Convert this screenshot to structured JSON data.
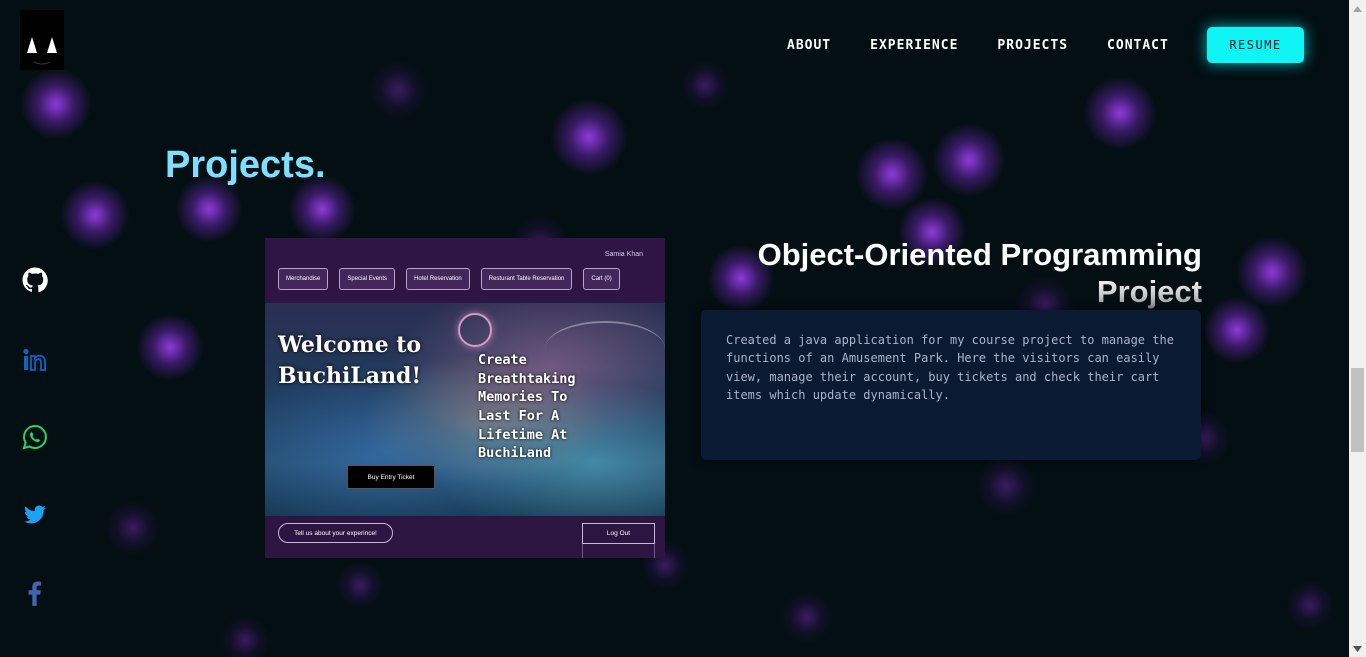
{
  "nav": {
    "links": [
      "ABOUT",
      "EXPERIENCE",
      "PROJECTS",
      "CONTACT"
    ],
    "resume_label": "RESUME"
  },
  "socials": [
    {
      "icon": "github-icon",
      "color": "#ffffff"
    },
    {
      "icon": "linkedin-icon",
      "color": "#0a66c2"
    },
    {
      "icon": "whatsapp-icon",
      "color": "#25d366"
    },
    {
      "icon": "twitter-icon",
      "color": "#1da1f2"
    },
    {
      "icon": "facebook-icon",
      "color": "#4267b2"
    }
  ],
  "section": {
    "title": "Projects."
  },
  "project": {
    "screenshot": {
      "author": "Samia Khan",
      "nav_items": [
        "Merchandise",
        "Special Events",
        "Hotel Reservation",
        "Resturant Table Reservation",
        "Cart (0)"
      ],
      "welcome_text": "Welcome to BuchiLand!",
      "tagline": "Create Breathtaking Memories To Last For A Lifetime At BuchiLand",
      "ticket_button": "Buy Entry Ticket",
      "experience_button": "Tell us about your experince!",
      "logout_button": "Log Out"
    },
    "title_line1": "Object-Oriented Programming",
    "title_line2": "Project",
    "description": "Created a java application for my course project to manage the functions of an Amusement Park. Here the visitors can easily view, manage their account, buy tickets and check their cart items which update dynamically."
  },
  "theme": {
    "background": "#030f12",
    "accent": "#0ff5f5",
    "title_color": "#7fdfff",
    "glow_color": "#9b3be6"
  }
}
